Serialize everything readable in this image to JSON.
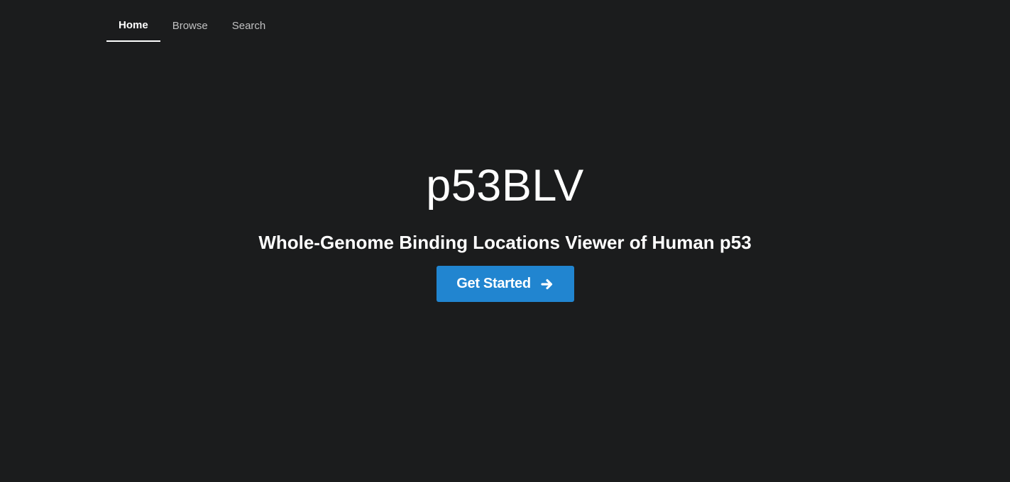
{
  "nav": {
    "items": [
      {
        "label": "Home",
        "active": true
      },
      {
        "label": "Browse",
        "active": false
      },
      {
        "label": "Search",
        "active": false
      }
    ]
  },
  "hero": {
    "title": "p53BLV",
    "subtitle": "Whole-Genome Binding Locations Viewer of Human p53",
    "cta_label": "Get Started",
    "cta_icon": "arrow-right-icon"
  },
  "colors": {
    "background": "#1b1c1d",
    "accent": "#2185d0",
    "text": "#ffffff"
  }
}
